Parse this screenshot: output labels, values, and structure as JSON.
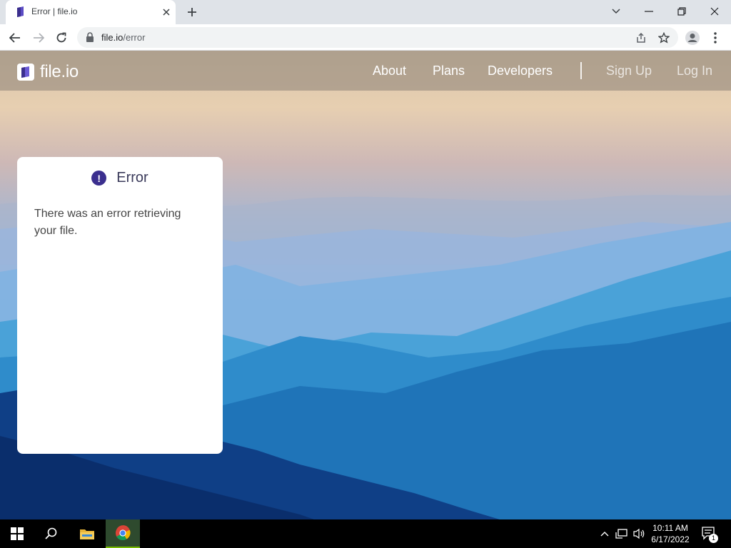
{
  "browser": {
    "tab": {
      "title": "Error | file.io"
    },
    "address": {
      "host": "file.io",
      "path": "/error"
    }
  },
  "site": {
    "logo_text": "file.io",
    "nav": {
      "about": "About",
      "plans": "Plans",
      "developers": "Developers",
      "signup": "Sign Up",
      "login": "Log In"
    }
  },
  "card": {
    "icon_glyph": "!",
    "title": "Error",
    "message": "There was an error retrieving your file."
  },
  "taskbar": {
    "time": "10:11 AM",
    "date": "6/17/2022",
    "notification_count": "1"
  },
  "colors": {
    "brand_purple": "#3b2f8e",
    "tab_bar": "#dfe3e8"
  }
}
